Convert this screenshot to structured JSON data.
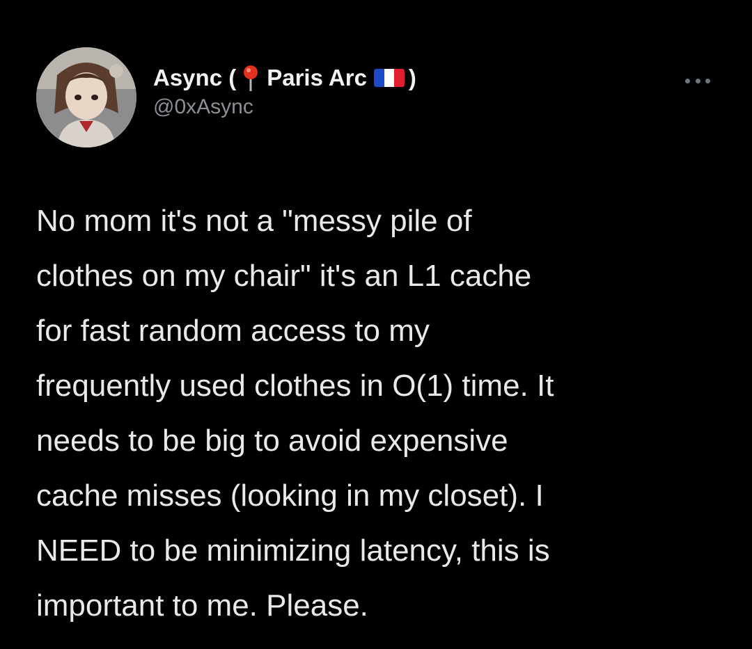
{
  "tweet": {
    "author": {
      "name_prefix": "Async (",
      "pin_icon": "round-pushpin-icon",
      "location": "Paris Arc",
      "flag_icon": "france-flag-icon",
      "name_suffix": ")",
      "handle": "@0xAsync"
    },
    "more_icon": "ellipsis-icon",
    "body_lines": [
      "No mom it's not a \"messy pile of",
      "clothes on my chair\" it's an L1 cache",
      "for fast random access to my",
      "frequently used clothes in O(1) time. It",
      "needs to be big to avoid expensive",
      "cache misses (looking in my closet). I",
      "NEED to be minimizing latency, this is",
      "important to me. Please."
    ]
  },
  "colors": {
    "background": "#000000",
    "text": "#e7e9ea",
    "handle": "#8b9096",
    "pin": "#e0301e",
    "flag_blue": "#1f49c7",
    "flag_white": "#ffffff",
    "flag_red": "#e0202f"
  }
}
